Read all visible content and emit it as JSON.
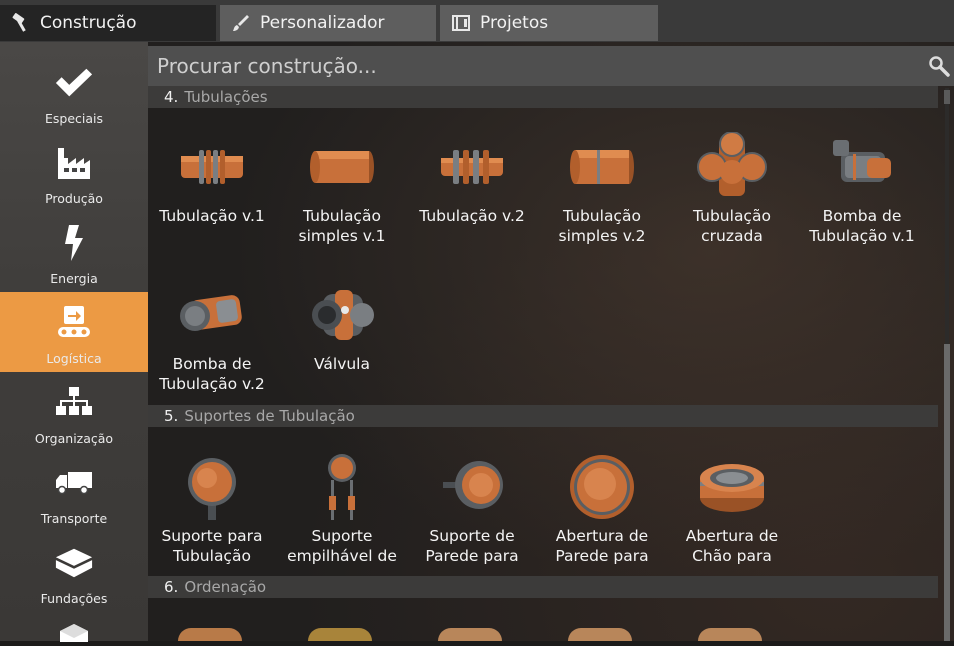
{
  "tabs": [
    {
      "label": "Construção",
      "icon": "hammer-icon"
    },
    {
      "label": "Personalizador",
      "icon": "brush-icon"
    },
    {
      "label": "Projetos",
      "icon": "blueprint-icon"
    }
  ],
  "search": {
    "placeholder": "Procurar construção..."
  },
  "sidebar": {
    "items": [
      {
        "label": "Especiais",
        "icon": "checkmark-icon"
      },
      {
        "label": "Produção",
        "icon": "factory-icon"
      },
      {
        "label": "Energia",
        "icon": "lightning-icon"
      },
      {
        "label": "Logística",
        "icon": "conveyor-icon",
        "active": true
      },
      {
        "label": "Organização",
        "icon": "hierarchy-icon"
      },
      {
        "label": "Transporte",
        "icon": "truck-icon"
      },
      {
        "label": "Fundações",
        "icon": "foundation-icon"
      }
    ]
  },
  "sections": [
    {
      "number": "4.",
      "name": "Tubulações",
      "items": [
        {
          "line1": "Tubulação v.1",
          "line2": "",
          "icon": "pipe-v1-icon"
        },
        {
          "line1": "Tubulação",
          "line2": "simples v.1",
          "icon": "pipe-simple-v1-icon"
        },
        {
          "line1": "Tubulação v.2",
          "line2": "",
          "icon": "pipe-v2-icon"
        },
        {
          "line1": "Tubulação",
          "line2": "simples v.2",
          "icon": "pipe-simple-v2-icon"
        },
        {
          "line1": "Tubulação",
          "line2": "cruzada",
          "icon": "pipe-junction-icon"
        },
        {
          "line1": "Bomba de",
          "line2": "Tubulação v.1",
          "icon": "pipe-pump-v1-icon"
        },
        {
          "line1": "Bomba de",
          "line2": "Tubulação v.2",
          "icon": "pipe-pump-v2-icon"
        },
        {
          "line1": "Válvula",
          "line2": "",
          "icon": "valve-icon"
        }
      ]
    },
    {
      "number": "5.",
      "name": "Suportes de Tubulação",
      "items": [
        {
          "line1": "Suporte para",
          "line2": "Tubulação",
          "icon": "pipe-support-icon"
        },
        {
          "line1": "Suporte",
          "line2": "empilhável de",
          "icon": "stackable-pipe-support-icon"
        },
        {
          "line1": "Suporte de",
          "line2": "Parede para",
          "icon": "wall-pipe-support-icon"
        },
        {
          "line1": "Abertura de",
          "line2": "Parede para",
          "icon": "wall-pipe-hole-icon"
        },
        {
          "line1": "Abertura de",
          "line2": "Chão para",
          "icon": "floor-pipe-hole-icon"
        }
      ]
    },
    {
      "number": "6.",
      "name": "Ordenação",
      "items": []
    }
  ],
  "colors": {
    "accent": "#ec9a44",
    "copper": "#c8703a",
    "steel": "#6a6e72"
  }
}
